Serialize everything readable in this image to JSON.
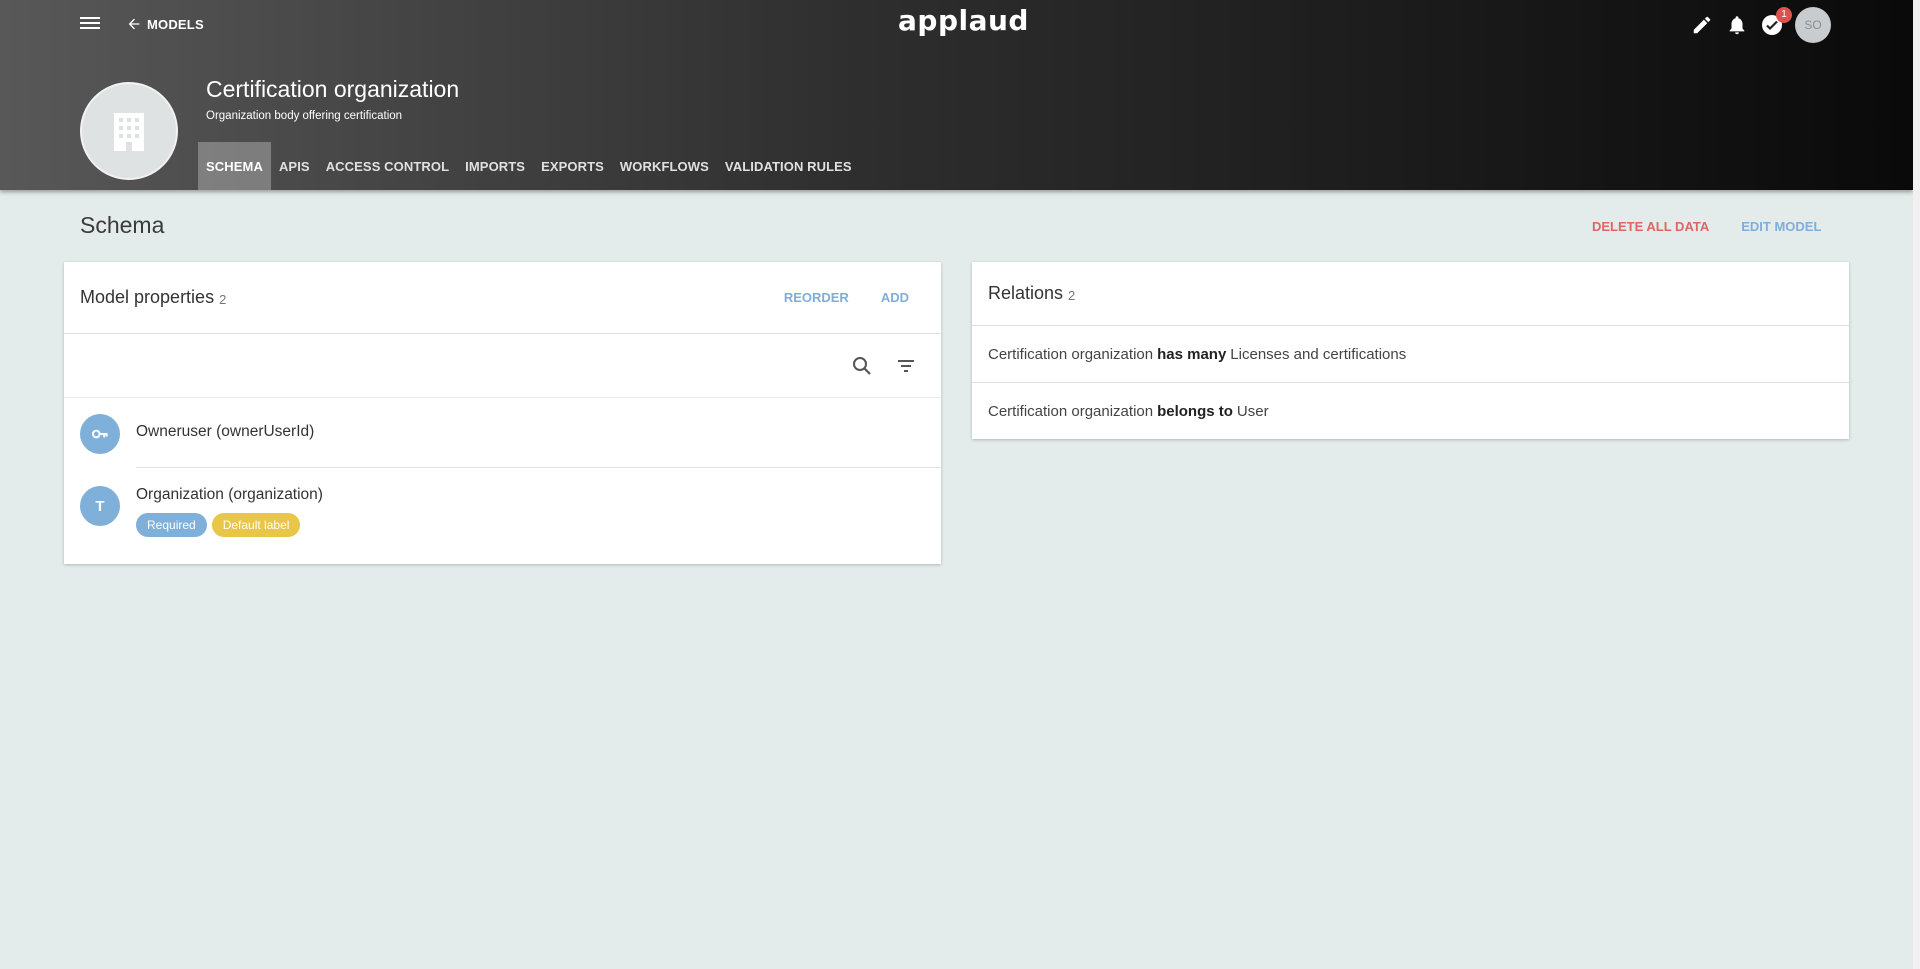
{
  "nav": {
    "back_label": "MODELS",
    "logo": "applaud",
    "notification_count": "1",
    "avatar_initials": "SO"
  },
  "model": {
    "title": "Certification organization",
    "subtitle": "Organization body offering certification"
  },
  "tabs": [
    {
      "label": "SCHEMA",
      "active": true
    },
    {
      "label": "APIS"
    },
    {
      "label": "ACCESS CONTROL"
    },
    {
      "label": "IMPORTS"
    },
    {
      "label": "EXPORTS"
    },
    {
      "label": "WORKFLOWS"
    },
    {
      "label": "VALIDATION RULES"
    }
  ],
  "page": {
    "title": "Schema",
    "delete_label": "DELETE ALL DATA",
    "edit_label": "EDIT MODEL"
  },
  "properties": {
    "title": "Model properties",
    "count": "2",
    "reorder_label": "REORDER",
    "add_label": "ADD",
    "items": [
      {
        "name": "Owneruser (ownerUserId)",
        "icon": "key-icon",
        "chips": []
      },
      {
        "name": "Organization (organization)",
        "icon": "text-type-icon",
        "icon_letter": "T",
        "chips": [
          "Required",
          "Default label"
        ]
      }
    ]
  },
  "relations": {
    "title": "Relations",
    "count": "2",
    "items": [
      {
        "subject": "Certification organization",
        "verb": "has many",
        "object": "Licenses and certifications"
      },
      {
        "subject": "Certification organization",
        "verb": "belongs to",
        "object": "User"
      }
    ]
  },
  "colors": {
    "background": "#e3ecea",
    "accent": "#7faedb",
    "danger": "#e06666",
    "chip_required": "#7fb0d9",
    "chip_label": "#e8c648"
  }
}
